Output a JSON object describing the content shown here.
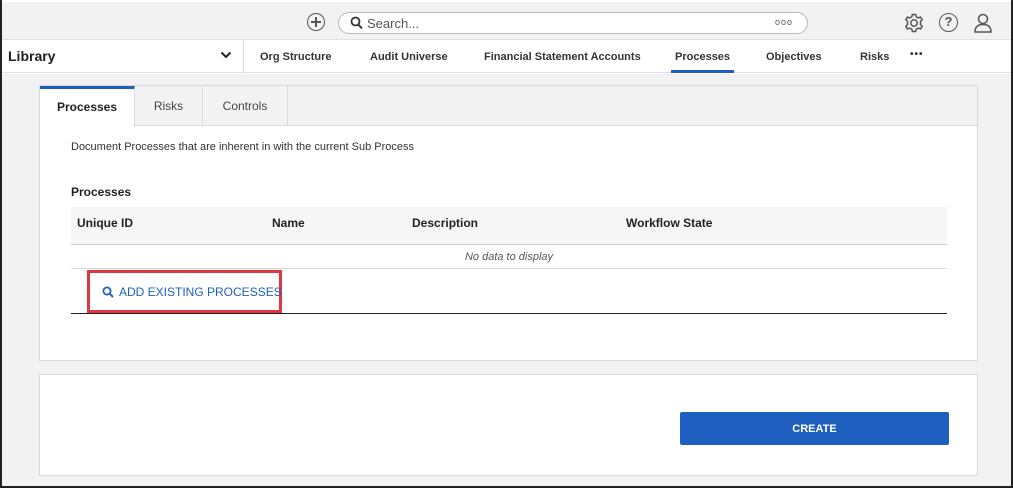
{
  "topbar": {
    "search_placeholder": "Search...",
    "more_label": "ooo",
    "icons": [
      "add-icon",
      "search-icon",
      "settings-icon",
      "help-icon",
      "user-icon"
    ]
  },
  "nav": {
    "library_label": "Library",
    "items": [
      {
        "label": "Org Structure"
      },
      {
        "label": "Audit Universe"
      },
      {
        "label": "Financial Statement Accounts"
      },
      {
        "label": "Processes",
        "active": true
      },
      {
        "label": "Objectives"
      },
      {
        "label": "Risks"
      }
    ],
    "more_label": "•••"
  },
  "tabs": [
    {
      "label": "Processes",
      "active": true
    },
    {
      "label": "Risks"
    },
    {
      "label": "Controls"
    }
  ],
  "panel": {
    "description": "Document Processes that are inherent in with the current Sub Process",
    "section_title": "Processes",
    "columns": [
      "Unique ID",
      "Name",
      "Description",
      "Workflow State"
    ],
    "empty_text": "No data to display",
    "add_existing_label": "ADD EXISTING PROCESSES"
  },
  "footer": {
    "create_label": "CREATE"
  },
  "colors": {
    "accent": "#1f5fbf",
    "highlight_border": "#e0363f"
  }
}
